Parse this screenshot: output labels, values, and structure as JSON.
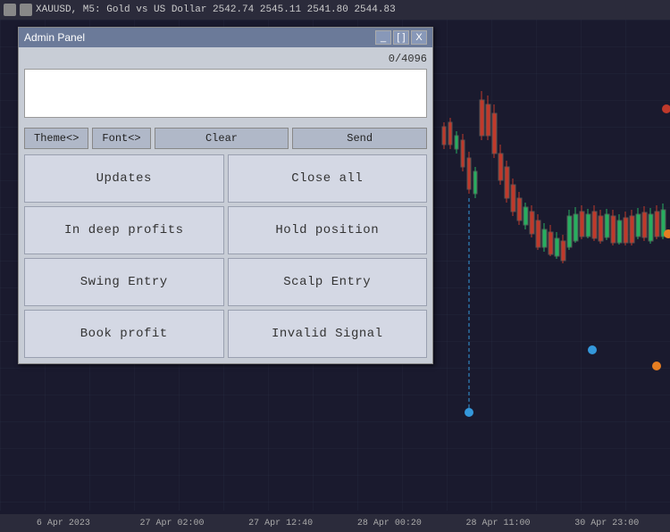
{
  "topbar": {
    "title": "XAUUSD, M5: Gold vs US Dollar  2542.74 2545.11 2541.80 2544.83"
  },
  "panel": {
    "title": "Admin Panel",
    "char_count": "0/4096",
    "minimize_label": "_",
    "bracket_label": "[ ]",
    "close_label": "X",
    "textarea_placeholder": "",
    "buttons": {
      "theme": "Theme<>",
      "font": "Font<>",
      "clear": "Clear",
      "send": "Send"
    },
    "grid_buttons": [
      {
        "id": "updates",
        "label": "Updates"
      },
      {
        "id": "close-all",
        "label": "Close all"
      },
      {
        "id": "in-deep-profits",
        "label": "In deep profits"
      },
      {
        "id": "hold-position",
        "label": "Hold position"
      },
      {
        "id": "swing-entry",
        "label": "Swing Entry"
      },
      {
        "id": "scalp-entry",
        "label": "Scalp Entry"
      },
      {
        "id": "book-profit",
        "label": "Book profit"
      },
      {
        "id": "invalid-signal",
        "label": "Invalid Signal"
      }
    ]
  },
  "chart": {
    "bottom_labels": [
      "6 Apr 2023",
      "27 Apr 02:00",
      "27 Apr 12:40",
      "28 Apr 00:20",
      "28 Apr 11:00",
      "30 Apr 23:00"
    ]
  }
}
